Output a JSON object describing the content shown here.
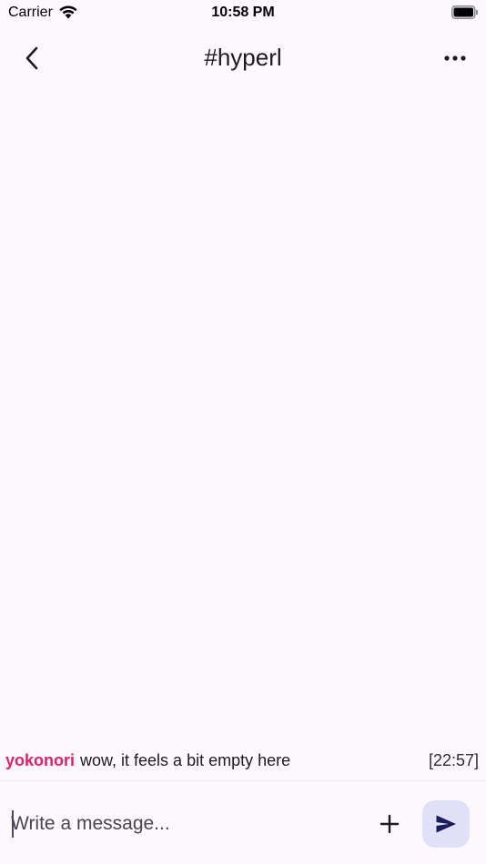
{
  "status_bar": {
    "carrier": "Carrier",
    "time": "10:58 PM",
    "wifi_icon": "wifi-icon",
    "battery_icon": "battery-icon"
  },
  "app_bar": {
    "title": "#hyperl",
    "back_icon": "chevron-left-icon",
    "more_icon": "more-horizontal-icon"
  },
  "messages": [
    {
      "user": "yokonori",
      "text": "wow, it feels a bit empty here",
      "time": "[22:57]"
    }
  ],
  "composer": {
    "placeholder": "Write a message...",
    "value": "",
    "add_icon": "plus-icon",
    "send_icon": "send-icon"
  },
  "colors": {
    "background": "#fcf8fe",
    "username": "#d8226b",
    "send_button_bg": "#e1e0f9",
    "send_icon": "#1b1c5a"
  }
}
